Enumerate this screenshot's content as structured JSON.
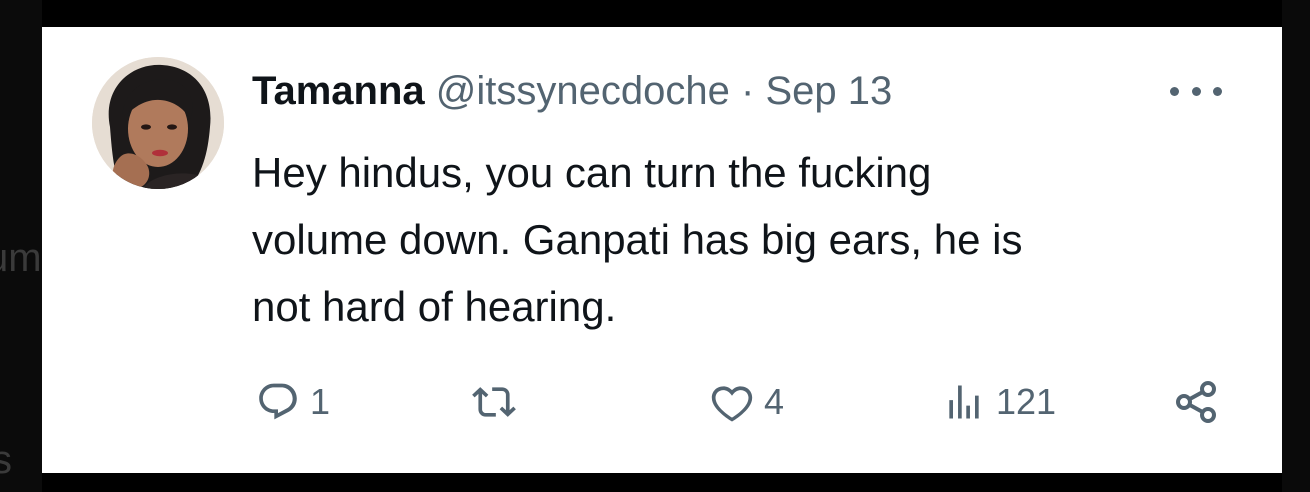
{
  "background": {
    "fragments": [
      "um",
      "/",
      "s"
    ]
  },
  "tweet": {
    "author_name": "Tamanna",
    "author_handle": "@itssynecdoche",
    "separator": "·",
    "date": "Sep 13",
    "text": "Hey hindus, you can turn the fucking\nvolume down. Ganpati has big ears, he is\nnot hard of hearing.",
    "avatar_icon": "profile-photo",
    "more_icon": "more-horizontal-icon"
  },
  "actions": {
    "reply": {
      "icon": "reply-icon",
      "count": "1"
    },
    "retweet": {
      "icon": "retweet-icon",
      "count": ""
    },
    "like": {
      "icon": "heart-icon",
      "count": "4"
    },
    "views": {
      "icon": "views-icon",
      "count": "121"
    },
    "share": {
      "icon": "share-icon"
    }
  },
  "colors": {
    "text_primary": "#0f1419",
    "text_secondary": "#536471",
    "card_bg": "#ffffff",
    "page_bg": "#000000"
  }
}
